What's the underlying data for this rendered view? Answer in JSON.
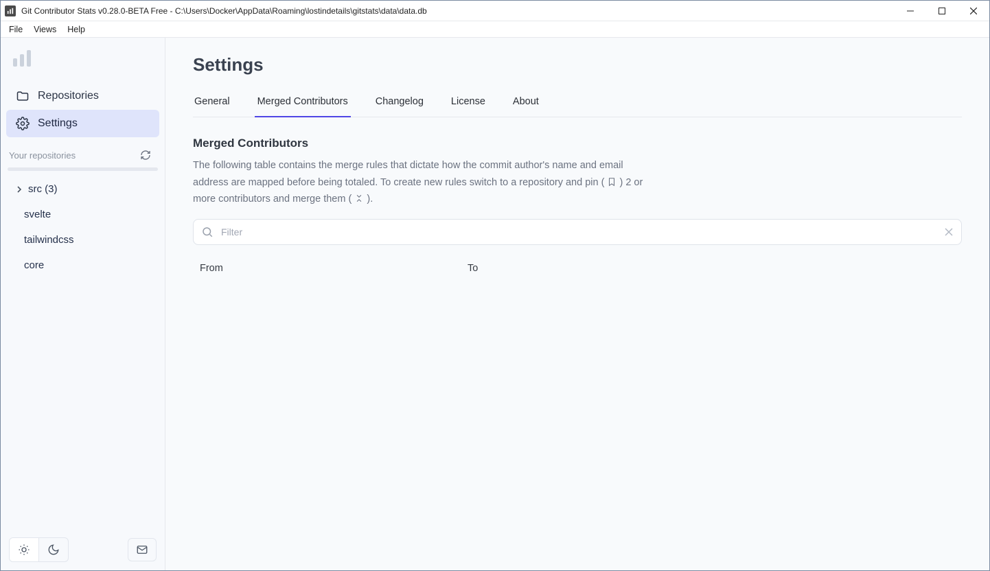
{
  "window": {
    "title": "Git Contributor Stats v0.28.0-BETA Free - C:\\Users\\Docker\\AppData\\Roaming\\lostindetails\\gitstats\\data\\data.db"
  },
  "menu": {
    "items": [
      "File",
      "Views",
      "Help"
    ]
  },
  "sidebar": {
    "nav": {
      "repositories": "Repositories",
      "settings": "Settings"
    },
    "section_label": "Your repositories",
    "repos": [
      {
        "label": "src (3)",
        "expandable": true
      },
      {
        "label": "svelte",
        "expandable": false
      },
      {
        "label": "tailwindcss",
        "expandable": false
      },
      {
        "label": "core",
        "expandable": false
      }
    ]
  },
  "page": {
    "title": "Settings",
    "tabs": [
      "General",
      "Merged Contributors",
      "Changelog",
      "License",
      "About"
    ],
    "active_tab": 1,
    "section_title": "Merged Contributors",
    "desc_part1": "The following table contains the merge rules that dictate how the commit author's name and email address are mapped before being totaled. To create new rules switch to a repository and pin (",
    "desc_part2": ") 2 or more contributors and merge them ( ",
    "desc_part3": " ).",
    "filter_placeholder": "Filter",
    "columns": {
      "from": "From",
      "to": "To"
    }
  }
}
